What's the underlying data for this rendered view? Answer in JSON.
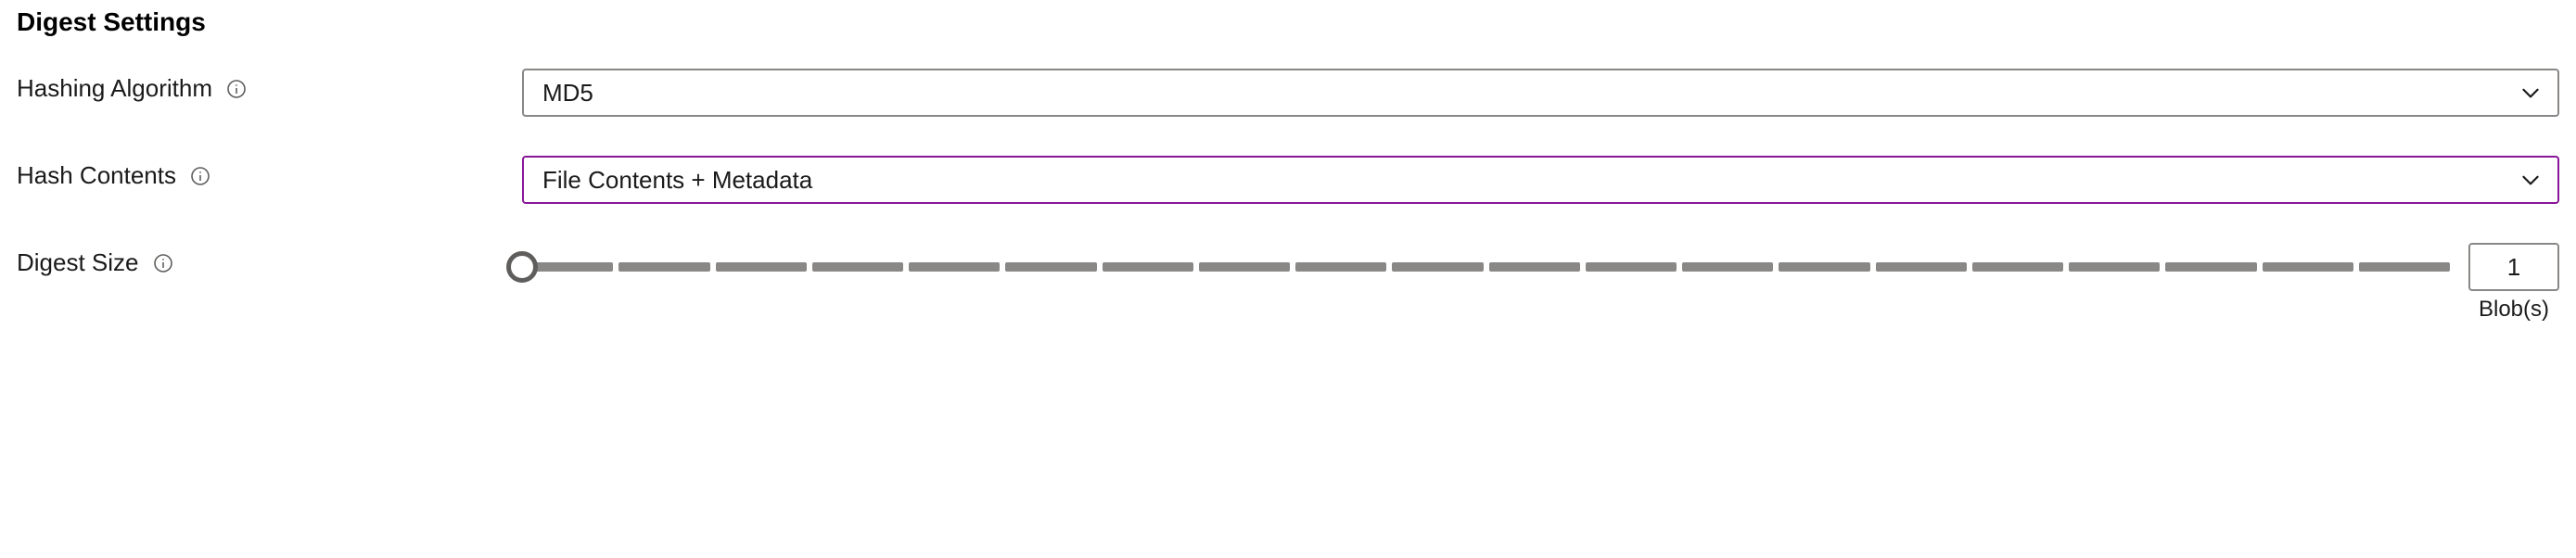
{
  "section": {
    "title": "Digest Settings"
  },
  "fields": {
    "algorithm": {
      "label": "Hashing Algorithm",
      "value": "MD5"
    },
    "contents": {
      "label": "Hash Contents",
      "value": "File Contents + Metadata"
    },
    "size": {
      "label": "Digest Size",
      "value": "1",
      "unit": "Blob(s)",
      "slider": {
        "min": 1,
        "max": 20,
        "segments": 20
      }
    }
  },
  "colors": {
    "accent": "#881798",
    "border": "#8a8886"
  }
}
